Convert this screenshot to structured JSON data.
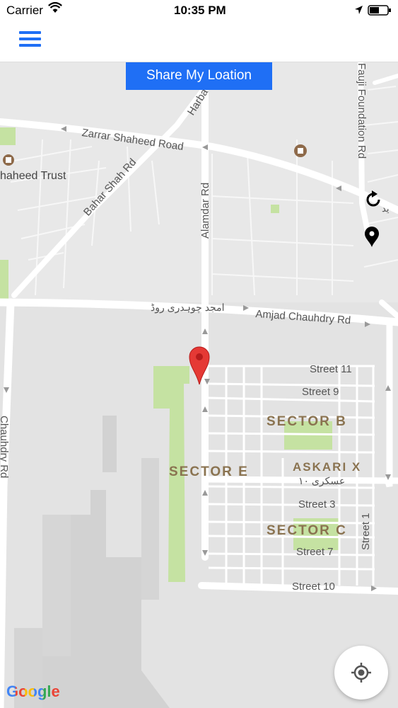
{
  "status_bar": {
    "carrier": "Carrier",
    "time": "10:35 PM"
  },
  "share_button": {
    "label": "Share My Loation"
  },
  "map": {
    "road_labels": {
      "zarrar": "Zarrar Shaheed Road",
      "bahar_shah": "Bahar Shah Rd",
      "alamdar": "Alamdar Rd",
      "harbour": "Harba",
      "fauji": "Fauji Foundation Rd",
      "amjad": "Amjad Chauhdry Rd",
      "amjad_urdu": "امجد چوہدری روڈ",
      "amjad_left": "Chauhdry Rd",
      "trust": "haheed Trust",
      "street11": "Street 11",
      "street9": "Street 9",
      "street3": "Street 3",
      "street7": "Street 7",
      "street10": "Street 10",
      "street1": "Street 1",
      "askari_urdu": "عسکری ١٠",
      "top_right_urdu": "ید"
    },
    "sector_labels": {
      "sector_b": "SECTOR B",
      "sector_e": "SECTOR E",
      "askari": "ASKARI X",
      "sector_c": "SECTOR C"
    },
    "attribution": "Google"
  },
  "icons": {
    "menu": "hamburger-menu-icon",
    "refresh": "refresh-icon",
    "pin": "location-pin-icon",
    "marker": "red-map-marker-icon",
    "locate": "my-location-icon"
  }
}
